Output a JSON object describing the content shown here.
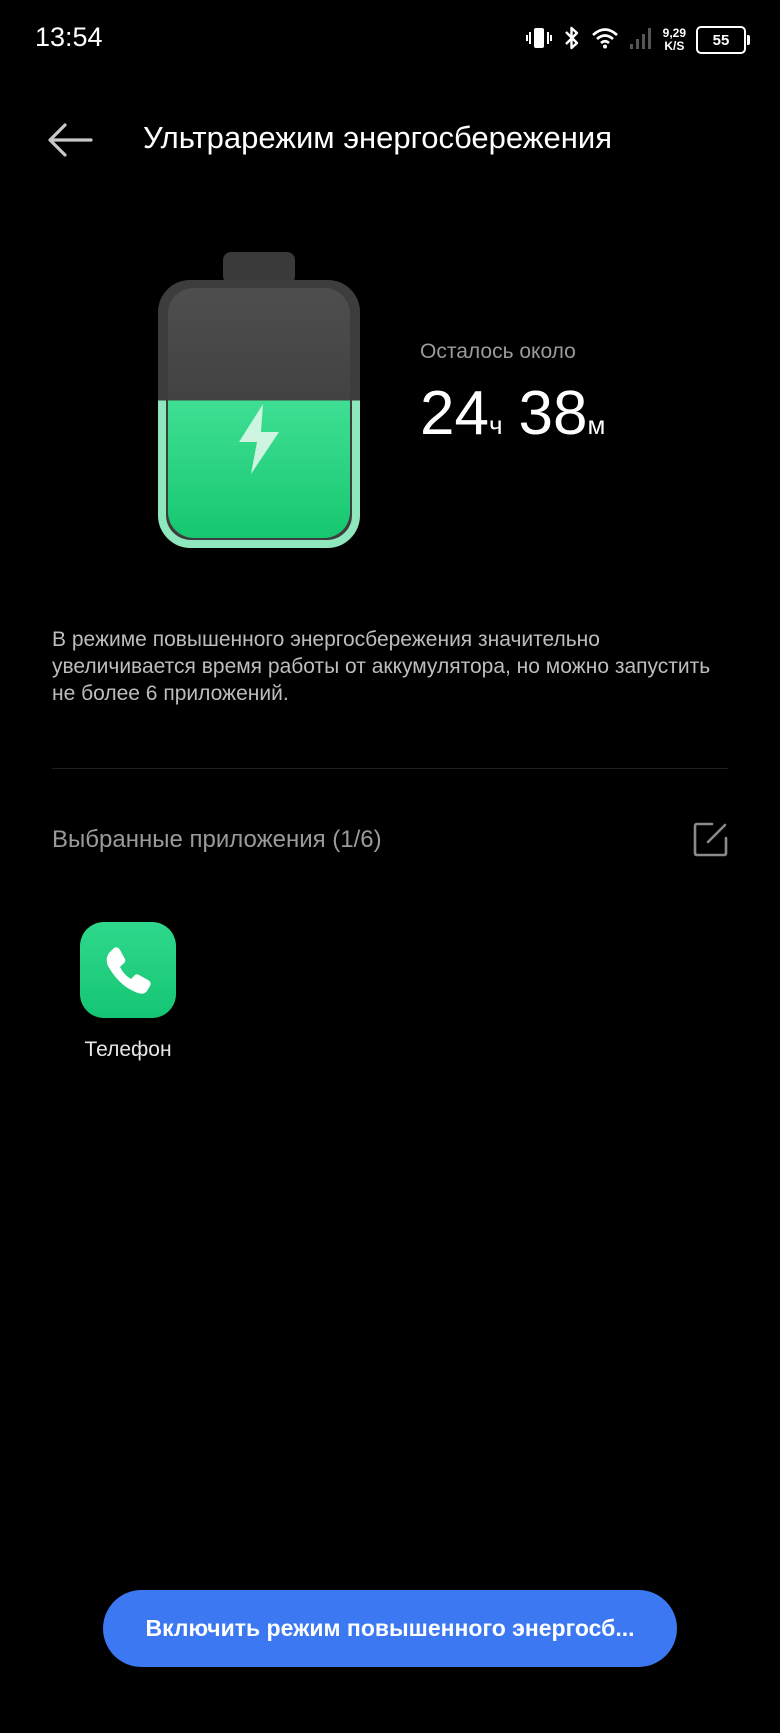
{
  "status_bar": {
    "time": "13:54",
    "net_speed_value": "9,29",
    "net_speed_unit": "K/S",
    "battery_level": "55"
  },
  "header": {
    "title": "Ультрарежим энергосбережения",
    "back_icon": "arrow-left-icon"
  },
  "battery_visual": {
    "charge_fraction": 0.55,
    "icon": "lightning-bolt-icon",
    "fill_color": "#1ed47c"
  },
  "remaining": {
    "label": "Осталось около",
    "hours": "24",
    "hours_unit": "ч",
    "minutes": "38",
    "minutes_unit": "м"
  },
  "description": "В режиме повышенного энергосбережения значительно увеличивается время работы от аккумулятора, но можно запустить не более 6 приложений.",
  "selected_apps": {
    "title": "Выбранные приложения (1/6)",
    "edit_icon": "edit-icon",
    "apps": [
      {
        "label": "Телефон",
        "icon": "phone-icon"
      }
    ]
  },
  "enable_button": {
    "label": "Включить режим повышенного энергосб..."
  },
  "colors": {
    "background": "#000000",
    "accent": "#3b78f2",
    "battery_green": "#1ed47c"
  }
}
